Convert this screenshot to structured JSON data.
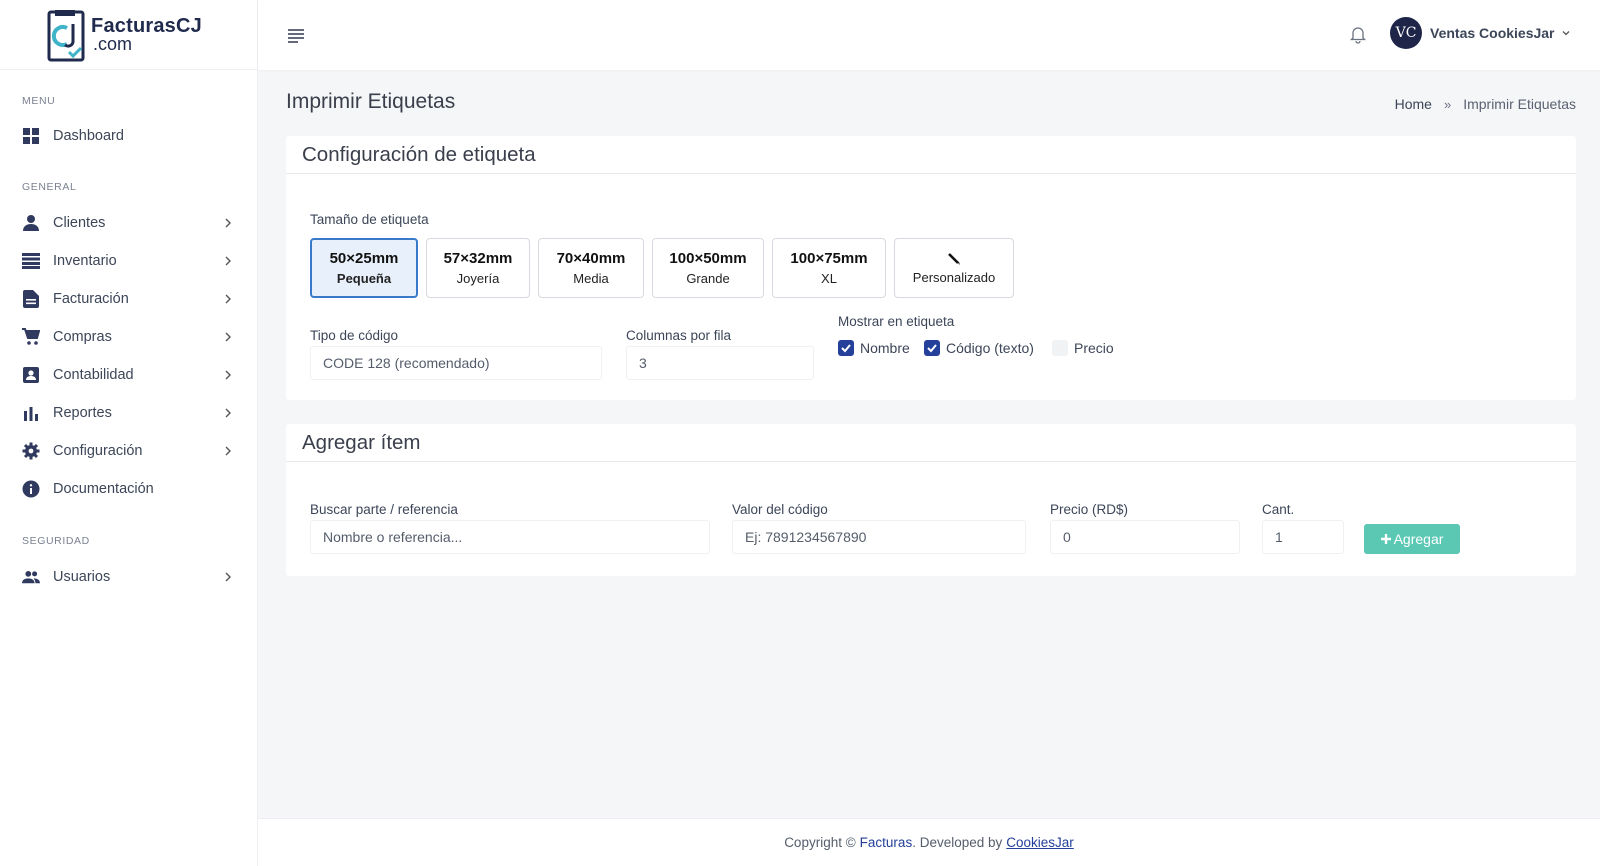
{
  "app": {
    "logo_name": "FacturasCJ",
    "logo_domain": ".com"
  },
  "sidebar": {
    "sections": [
      {
        "title": "MENU"
      },
      {
        "title": "GENERAL"
      },
      {
        "title": "SEGURIDAD"
      }
    ],
    "items": [
      {
        "label": "Dashboard",
        "icon": "dashboard-icon"
      },
      {
        "label": "Clientes",
        "icon": "person-icon"
      },
      {
        "label": "Inventario",
        "icon": "inventory-icon"
      },
      {
        "label": "Facturación",
        "icon": "document-icon"
      },
      {
        "label": "Compras",
        "icon": "cart-icon"
      },
      {
        "label": "Contabilidad",
        "icon": "contact-book-icon"
      },
      {
        "label": "Reportes",
        "icon": "bar-chart-icon"
      },
      {
        "label": "Configuración",
        "icon": "gear-icon"
      },
      {
        "label": "Documentación",
        "icon": "info-icon"
      },
      {
        "label": "Usuarios",
        "icon": "users-icon"
      }
    ]
  },
  "topbar": {
    "user_initials": "VC",
    "user_name": "Ventas CookiesJar"
  },
  "page": {
    "title": "Imprimir Etiquetas",
    "breadcrumb_home": "Home",
    "breadcrumb_sep": "»",
    "breadcrumb_current": "Imprimir Etiquetas"
  },
  "config_card": {
    "title": "Configuración de etiqueta",
    "size_label": "Tamaño de etiqueta",
    "sizes": [
      {
        "main": "50×25mm",
        "sub": "Pequeña",
        "active": true
      },
      {
        "main": "57×32mm",
        "sub": "Joyería",
        "active": false
      },
      {
        "main": "70×40mm",
        "sub": "Media",
        "active": false
      },
      {
        "main": "100×50mm",
        "sub": "Grande",
        "active": false
      },
      {
        "main": "100×75mm",
        "sub": "XL",
        "active": false
      },
      {
        "main": "",
        "sub": "Personalizado",
        "icon": "pencil-icon",
        "active": false
      }
    ],
    "code_type_label": "Tipo de código",
    "code_type_value": "CODE 128 (recomendado)",
    "columns_label": "Columnas por fila",
    "columns_value": "3",
    "show_label": "Mostrar en etiqueta",
    "checkboxes": [
      {
        "label": "Nombre",
        "checked": true
      },
      {
        "label": "Código (texto)",
        "checked": true
      },
      {
        "label": "Precio",
        "checked": false
      }
    ]
  },
  "add_card": {
    "title": "Agregar ítem",
    "search_label": "Buscar parte / referencia",
    "search_placeholder": "Nombre o referencia...",
    "code_label": "Valor del código",
    "code_placeholder": "Ej: 7891234567890",
    "price_label": "Precio (RD$)",
    "price_value": "0",
    "qty_label": "Cant.",
    "qty_value": "1",
    "add_button": "Agregar"
  },
  "footer": {
    "prefix": "Copyright ©",
    "brand": "Facturas",
    "middle": ". Developed by",
    "developer": "CookiesJar"
  },
  "colors": {
    "navy": "#1e2548",
    "accent_blue": "#24409a",
    "active_border": "#3a78c9",
    "teal_button": "#5bc8b4"
  }
}
